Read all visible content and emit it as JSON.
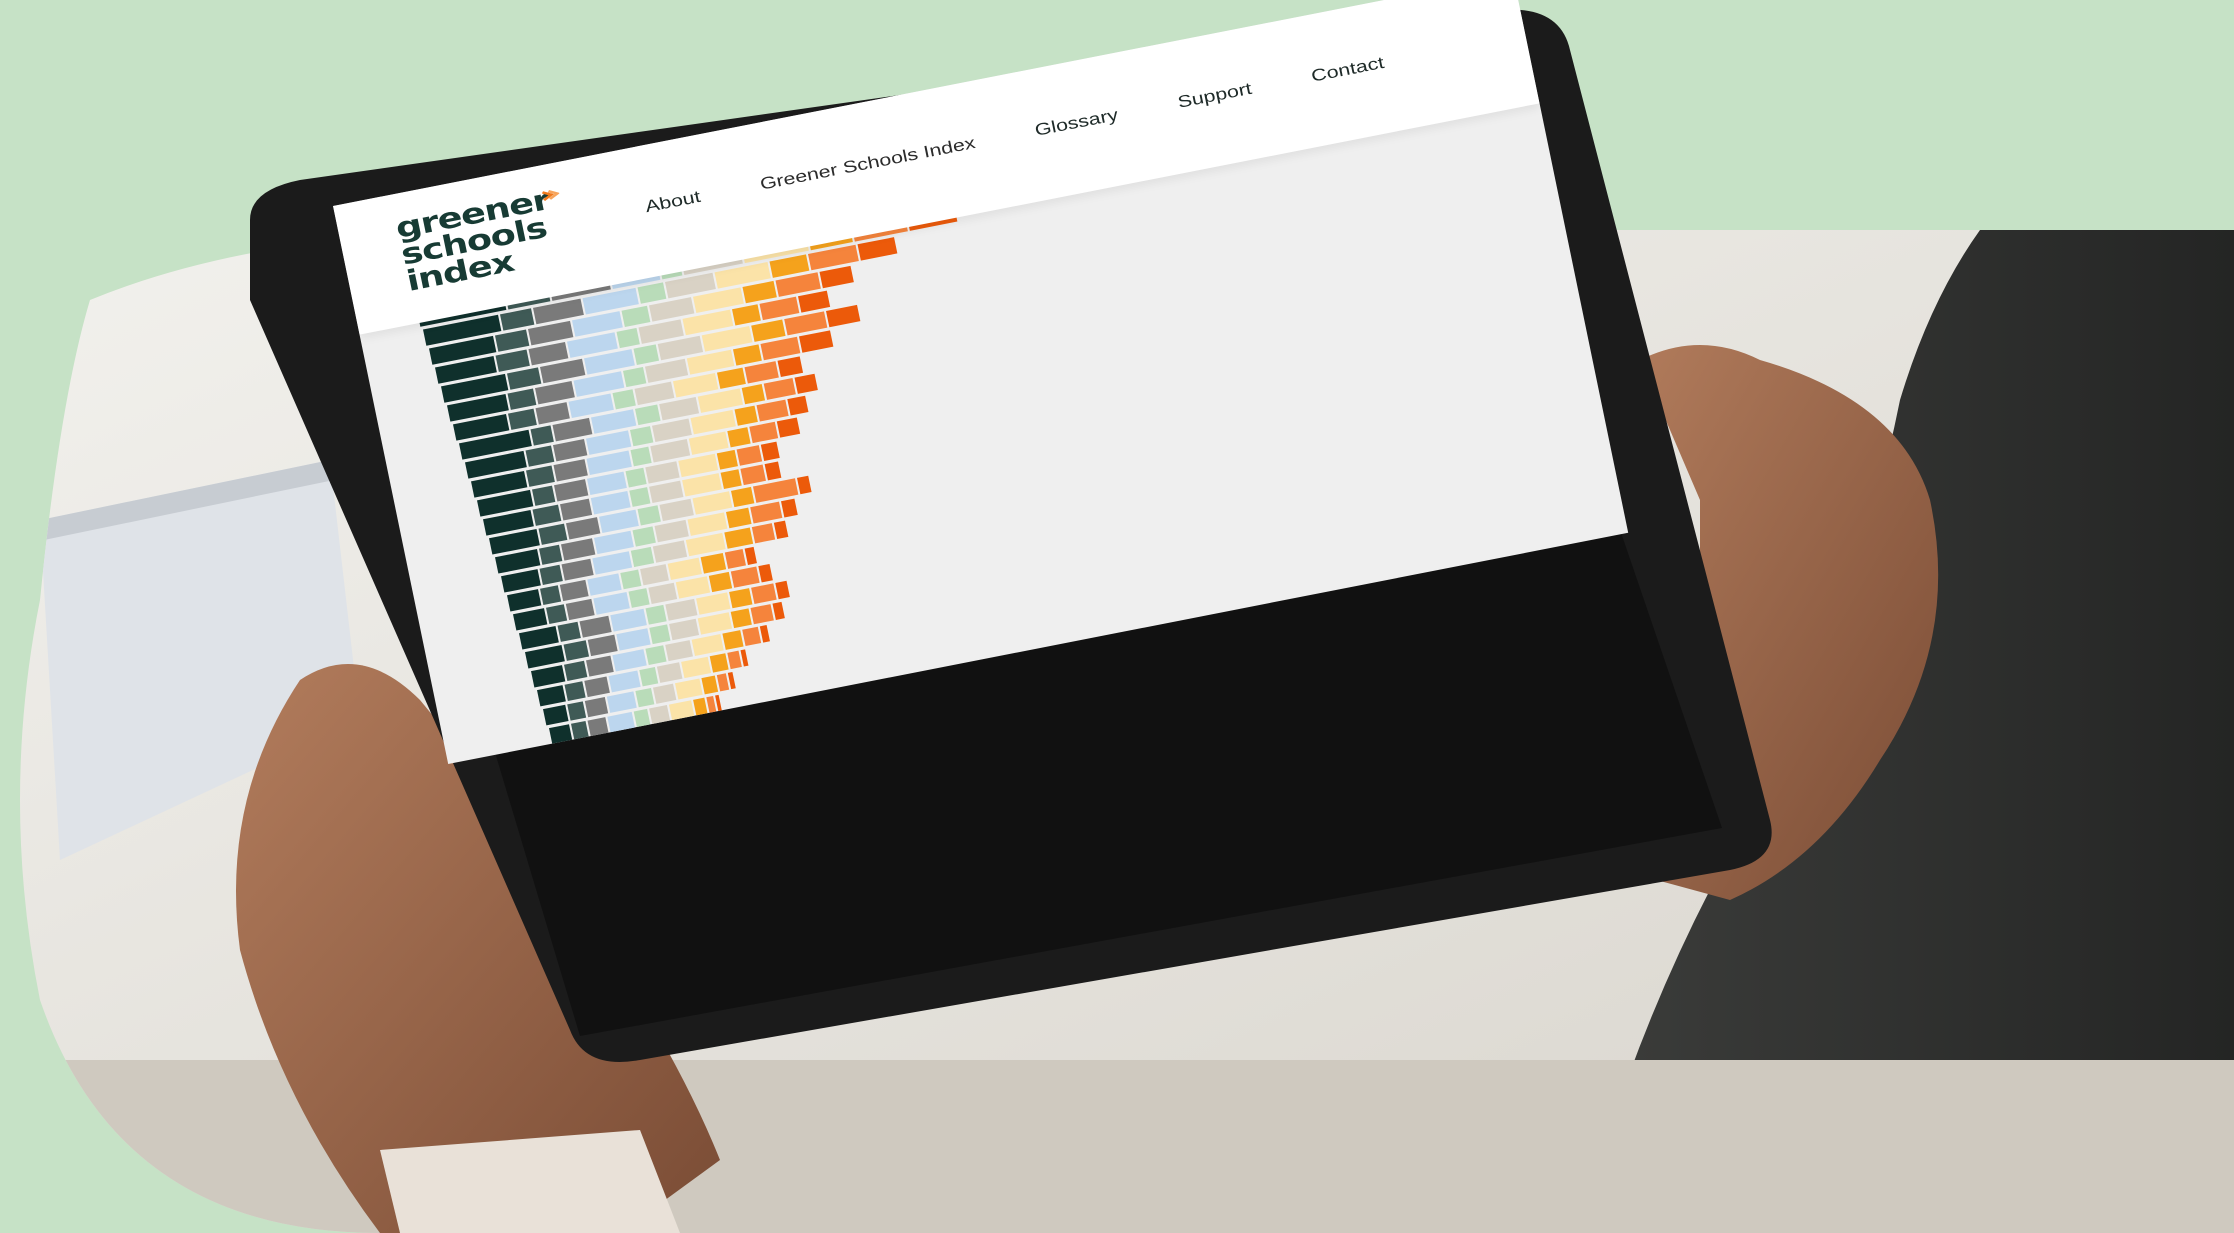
{
  "brand": {
    "logo_lines": [
      "greener",
      "schools",
      "index"
    ],
    "text_color": "#173b34",
    "accent_color": "#f07a1e"
  },
  "nav": {
    "items": [
      {
        "label": "About"
      },
      {
        "label": "Greener Schools Index"
      },
      {
        "label": "Glossary"
      },
      {
        "label": "Support"
      },
      {
        "label": "Contact"
      }
    ]
  },
  "colors": {
    "background": "#c6e2c6",
    "screen_background": "#efefef",
    "header_background": "#ffffff"
  },
  "chart_data": {
    "type": "bar",
    "orientation": "horizontal",
    "stacked": true,
    "segment_colors": [
      "#0f302c",
      "#3f5a56",
      "#7a7a7a",
      "#bcd6ee",
      "#b9dcb9",
      "#d9d2c5",
      "#fbe3a8",
      "#f5a21c",
      "#f5843c",
      "#ec5a0a"
    ],
    "rows": [
      [
        80,
        40,
        55,
        45,
        20,
        55,
        60,
        40,
        50,
        45
      ],
      [
        70,
        30,
        45,
        50,
        25,
        45,
        50,
        35,
        45,
        35
      ],
      [
        60,
        30,
        40,
        45,
        25,
        40,
        45,
        30,
        40,
        30
      ],
      [
        55,
        30,
        35,
        45,
        20,
        40,
        45,
        25,
        35,
        28
      ],
      [
        60,
        30,
        40,
        45,
        22,
        40,
        45,
        30,
        38,
        30
      ],
      [
        55,
        25,
        35,
        45,
        20,
        38,
        42,
        25,
        35,
        30
      ],
      [
        50,
        25,
        30,
        40,
        20,
        35,
        40,
        25,
        30,
        22
      ],
      [
        65,
        20,
        35,
        40,
        22,
        35,
        40,
        20,
        28,
        20
      ],
      [
        55,
        25,
        30,
        40,
        20,
        35,
        40,
        20,
        28,
        18
      ],
      [
        50,
        25,
        30,
        40,
        18,
        35,
        35,
        20,
        25,
        20
      ],
      [
        50,
        20,
        30,
        35,
        18,
        30,
        35,
        18,
        22,
        16
      ],
      [
        45,
        25,
        28,
        35,
        18,
        30,
        35,
        18,
        22,
        14
      ],
      [
        45,
        25,
        30,
        35,
        20,
        30,
        35,
        20,
        40,
        12
      ],
      [
        40,
        20,
        30,
        35,
        20,
        30,
        35,
        22,
        28,
        14
      ],
      [
        35,
        20,
        28,
        35,
        20,
        30,
        35,
        25,
        20,
        12
      ],
      [
        30,
        18,
        25,
        30,
        18,
        25,
        30,
        22,
        18,
        10
      ],
      [
        30,
        18,
        25,
        32,
        18,
        25,
        30,
        20,
        25,
        12
      ],
      [
        35,
        20,
        28,
        32,
        18,
        28,
        30,
        20,
        22,
        12
      ],
      [
        35,
        22,
        26,
        30,
        18,
        26,
        30,
        18,
        20,
        10
      ],
      [
        30,
        20,
        24,
        30,
        18,
        24,
        28,
        18,
        16,
        8
      ],
      [
        25,
        18,
        22,
        28,
        16,
        22,
        26,
        16,
        12,
        6
      ],
      [
        22,
        16,
        20,
        26,
        16,
        20,
        24,
        14,
        10,
        6
      ],
      [
        20,
        15,
        18,
        24,
        14,
        18,
        22,
        12,
        8,
        5
      ],
      [
        18,
        14,
        16,
        22,
        14,
        16,
        20,
        10,
        8,
        5
      ],
      [
        16,
        12,
        14,
        20,
        12,
        14,
        18,
        8,
        6,
        4
      ],
      [
        14,
        10,
        12,
        18,
        10,
        12,
        16,
        6,
        4,
        3
      ]
    ]
  }
}
